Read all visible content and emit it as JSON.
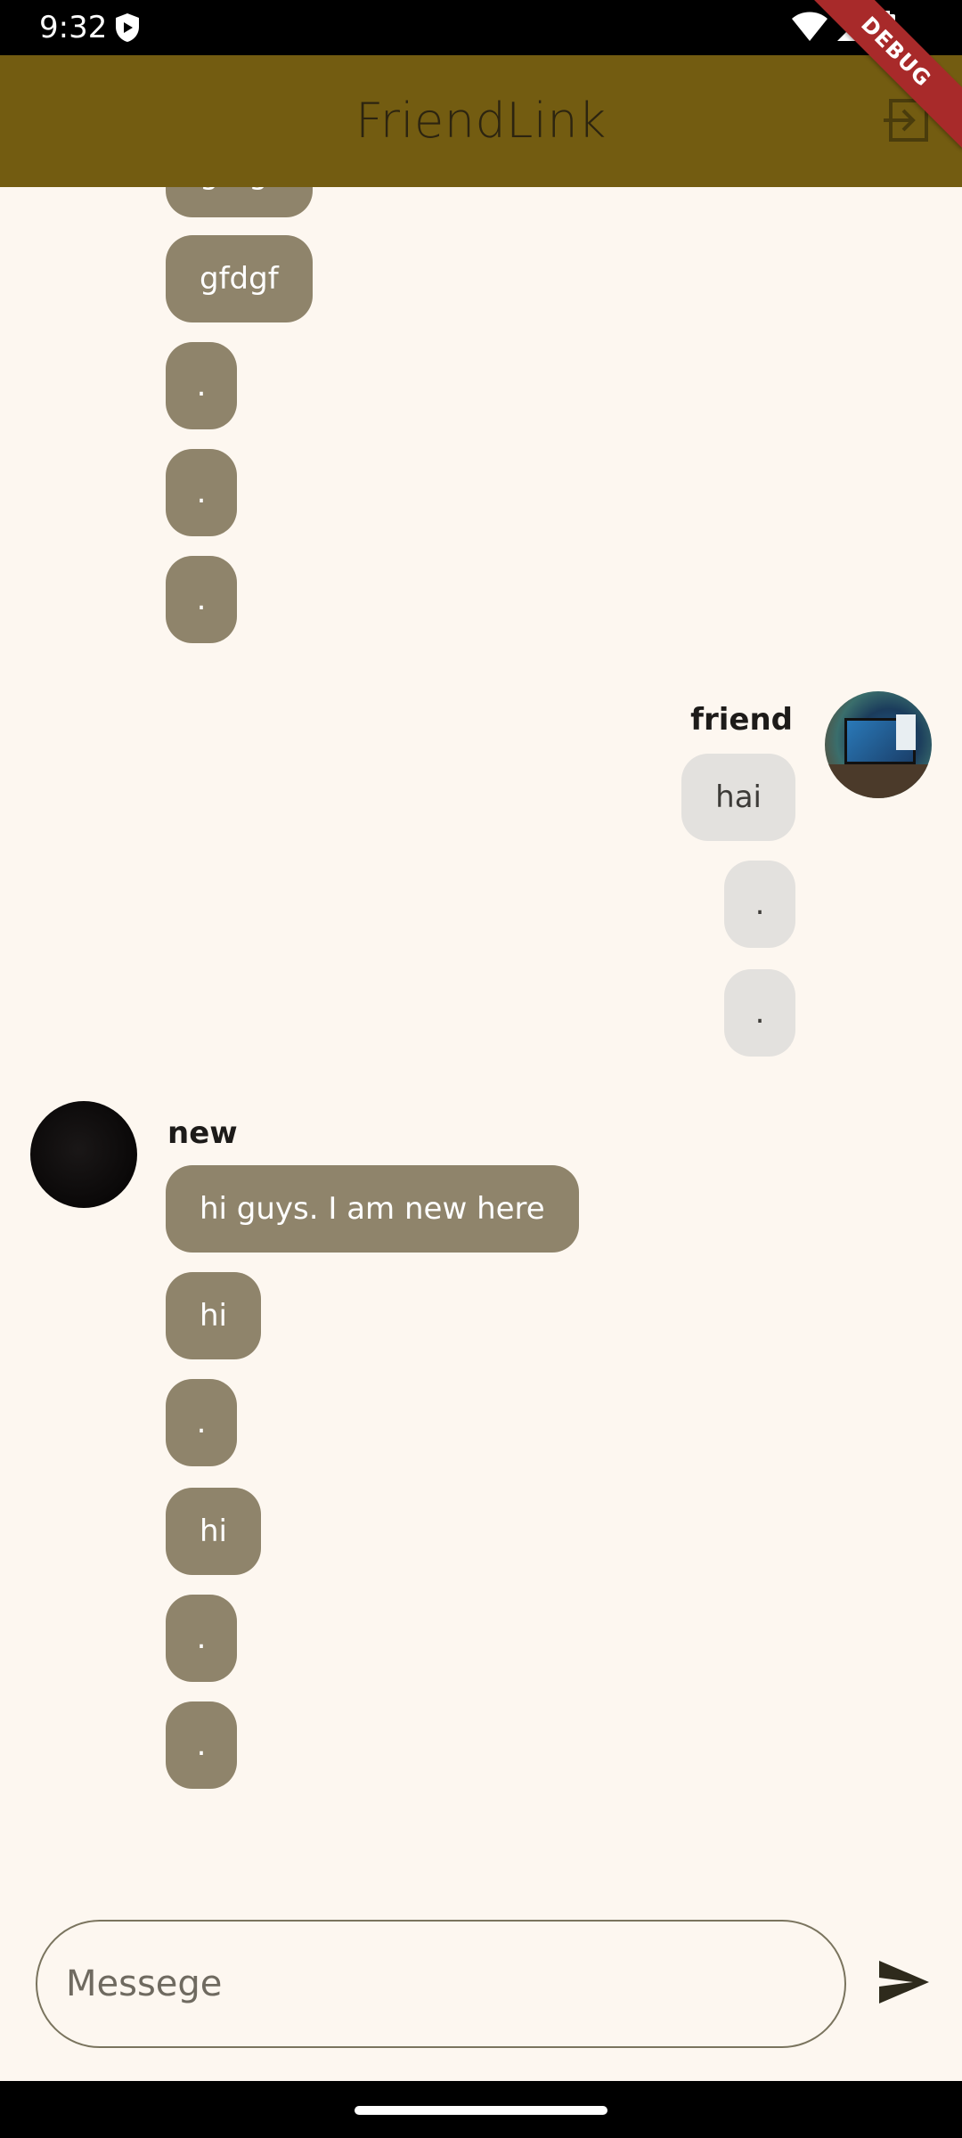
{
  "status_bar": {
    "time": "9:32"
  },
  "app_bar": {
    "title": "FriendLink",
    "debug_label": "DEBUG"
  },
  "chat": {
    "partial_top": {
      "text": "gfdgf"
    },
    "group1": {
      "messages": [
        "gfdgf",
        ".",
        ".",
        "."
      ]
    },
    "friend": {
      "name": "friend",
      "messages": [
        "hai",
        ".",
        "."
      ]
    },
    "new_user": {
      "name": "new",
      "messages": [
        "hi guys.  I am new here",
        "hi",
        ".",
        "hi",
        ".",
        "."
      ]
    }
  },
  "composer": {
    "placeholder": "Messege"
  },
  "colors": {
    "app_bar": "#735c11",
    "background": "#fdf7f0",
    "incoming_bubble": "#8f846b",
    "outgoing_bubble": "#e3e1de"
  },
  "icons": [
    "shield-icon",
    "wifi-icon",
    "signal-icon",
    "battery-icon",
    "logout-icon",
    "send-icon"
  ]
}
